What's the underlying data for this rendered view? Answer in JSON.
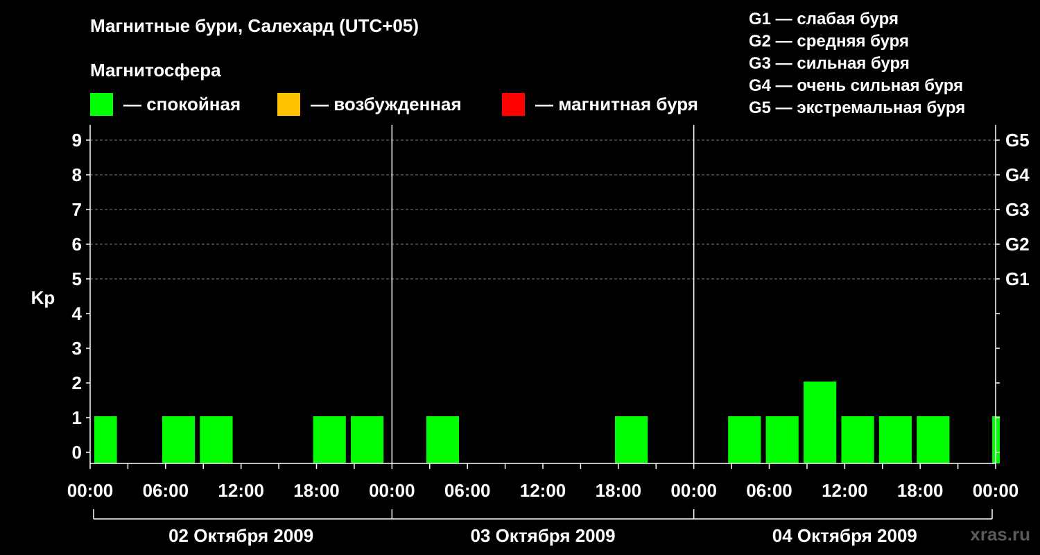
{
  "header": {
    "title": "Магнитные бури, Салехард (UTC+05)",
    "subtitle": "Магнитосфера"
  },
  "legend": [
    {
      "label": "— спокойная",
      "color": "#00ff00"
    },
    {
      "label": "— возбужденная",
      "color": "#ffc000"
    },
    {
      "label": "— магнитная буря",
      "color": "#ff0000"
    }
  ],
  "storm_scale": [
    "G1 — слабая буря",
    "G2 — средняя буря",
    "G3 — сильная буря",
    "G4 — очень сильная буря",
    "G5 — экстремальная буря"
  ],
  "watermark": "xras.ru",
  "colors": {
    "background": "#000000",
    "grid": "#808080",
    "quiet": "#00ff00"
  },
  "chart_data": {
    "type": "bar",
    "ylabel": "Kp",
    "ylim": [
      0,
      9
    ],
    "y_ticks": [
      "0",
      "1",
      "2",
      "3",
      "4",
      "5",
      "6",
      "7",
      "8",
      "9"
    ],
    "right_axis_labels": [
      {
        "kp": 5,
        "label": "G1"
      },
      {
        "kp": 6,
        "label": "G2"
      },
      {
        "kp": 7,
        "label": "G3"
      },
      {
        "kp": 8,
        "label": "G4"
      },
      {
        "kp": 9,
        "label": "G5"
      }
    ],
    "x_tick_labels": [
      "00:00",
      "06:00",
      "12:00",
      "18:00",
      "00:00",
      "06:00",
      "12:00",
      "18:00",
      "00:00",
      "06:00",
      "12:00",
      "18:00",
      "00:00"
    ],
    "days": [
      "02 Октября 2009",
      "03 Октября 2009",
      "04 Октября 2009"
    ],
    "bars": [
      {
        "day": 0,
        "start_hour": 0,
        "end_hour": 1.8,
        "kp": 1
      },
      {
        "day": 0,
        "start_hour": 5.4,
        "end_hour": 8,
        "kp": 1
      },
      {
        "day": 0,
        "start_hour": 8.4,
        "end_hour": 11,
        "kp": 1
      },
      {
        "day": 0,
        "start_hour": 17.4,
        "end_hour": 20,
        "kp": 1
      },
      {
        "day": 0,
        "start_hour": 20.4,
        "end_hour": 23,
        "kp": 1
      },
      {
        "day": 1,
        "start_hour": 2.4,
        "end_hour": 5,
        "kp": 1
      },
      {
        "day": 1,
        "start_hour": 17.4,
        "end_hour": 20,
        "kp": 1
      },
      {
        "day": 2,
        "start_hour": 2.4,
        "end_hour": 5,
        "kp": 1
      },
      {
        "day": 2,
        "start_hour": 5.4,
        "end_hour": 8,
        "kp": 1
      },
      {
        "day": 2,
        "start_hour": 8.4,
        "end_hour": 11,
        "kp": 2
      },
      {
        "day": 2,
        "start_hour": 11.4,
        "end_hour": 14,
        "kp": 1
      },
      {
        "day": 2,
        "start_hour": 14.4,
        "end_hour": 17,
        "kp": 1
      },
      {
        "day": 2,
        "start_hour": 17.4,
        "end_hour": 20,
        "kp": 1
      },
      {
        "day": 2,
        "start_hour": 23.4,
        "end_hour": 24,
        "kp": 1
      }
    ],
    "grid": true
  }
}
